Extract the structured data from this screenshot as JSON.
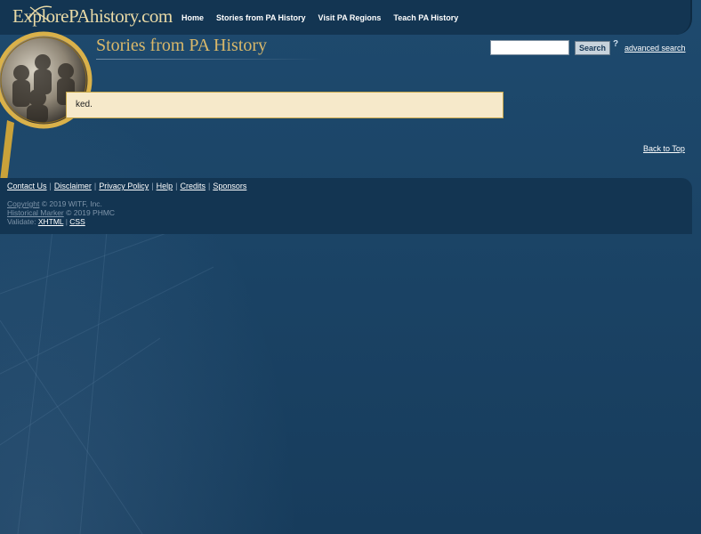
{
  "header": {
    "logo_text": "ExplorePAhistory.com",
    "nav": [
      "Home",
      "Stories from PA History",
      "Visit PA Regions",
      "Teach PA History"
    ]
  },
  "page": {
    "title": "Stories from PA History",
    "message": "ked."
  },
  "search": {
    "value": "",
    "button_label": "Search",
    "help_glyph": "?",
    "advanced_label": "advanced search"
  },
  "back_to_top": "Back to Top",
  "footer": {
    "links": [
      "Contact Us",
      "Disclaimer",
      "Privacy Policy",
      "Help",
      "Credits",
      "Sponsors"
    ],
    "copyright_link": "Copyright",
    "copyright_text": "© 2019 WITF, Inc.",
    "marker_link": "Historical Marker",
    "marker_text": "© 2019 PHMC",
    "validate_label": "Validate:",
    "xhtml": "XHTML",
    "css": "CSS"
  },
  "colors": {
    "background": "#1c4466",
    "header_bar": "#133552",
    "title_gold": "#d9b86a",
    "message_bg": "#f6e9ca"
  },
  "icons": [
    "magnifying-glass-photo",
    "help-icon",
    "logo-swoosh"
  ]
}
